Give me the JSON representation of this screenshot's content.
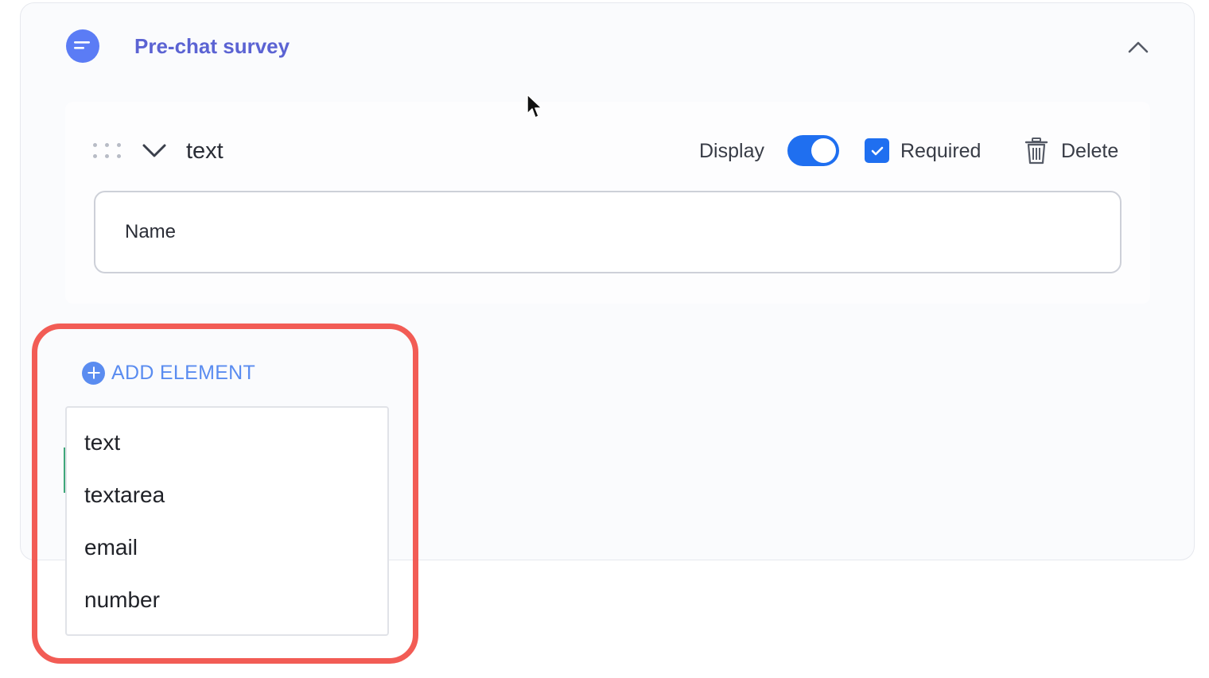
{
  "section": {
    "title": "Pre-chat survey",
    "icon": "chat-bubble-icon",
    "accent_color": "#5b63d3"
  },
  "field": {
    "type_label": "text",
    "display_label": "Display",
    "display_on": true,
    "required_label": "Required",
    "required_checked": true,
    "delete_label": "Delete",
    "input_value": "Name",
    "toggle_color": "#1f6ff0"
  },
  "add_element": {
    "label": "ADD ELEMENT",
    "color": "#5a8cf0",
    "options": [
      "text",
      "textarea",
      "email",
      "number"
    ]
  },
  "highlight_color": "#f25c55"
}
